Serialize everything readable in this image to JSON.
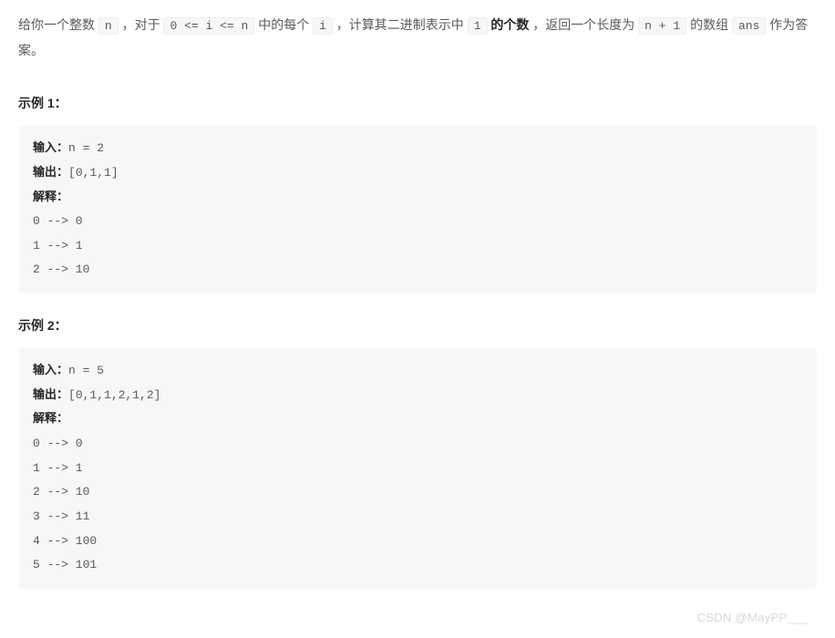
{
  "statement": {
    "part1": "给你一个整数 ",
    "code1": "n",
    "part2": " ，对于 ",
    "code2": "0 <= i <= n",
    "part3": " 中的每个 ",
    "code3": "i",
    "part4": " ，计算其二进制表示中 ",
    "code4": "1",
    "bold": " 的个数",
    "part5": " ，返回一个长度为 ",
    "code5": "n + 1",
    "part6": " 的数组 ",
    "code6": "ans",
    "part7": " 作为答案。"
  },
  "example1": {
    "title": "示例 1：",
    "labelInput": "输入：",
    "input": "n = 2",
    "labelOutput": "输出：",
    "output": "[0,1,1]",
    "labelExplain": "解释：",
    "explainLines": "0 --> 0\n1 --> 1\n2 --> 10"
  },
  "example2": {
    "title": "示例 2：",
    "labelInput": "输入：",
    "input": "n = 5",
    "labelOutput": "输出：",
    "output": "[0,1,1,2,1,2]",
    "labelExplain": "解释：",
    "explainLines": "0 --> 0\n1 --> 1\n2 --> 10\n3 --> 11\n4 --> 100\n5 --> 101"
  },
  "watermark": "CSDN @MayPP___"
}
